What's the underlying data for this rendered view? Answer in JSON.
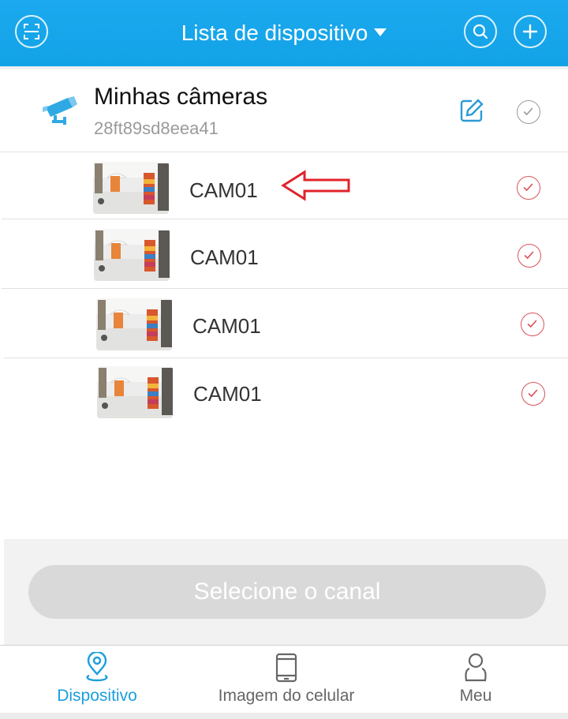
{
  "header": {
    "title": "Lista de dispositivo",
    "icons": {
      "scan": "scan-icon",
      "search": "search-icon",
      "add": "plus-icon",
      "dropdown": "caret-down-icon"
    },
    "color": "#12a2e6"
  },
  "group": {
    "name": "Minhas câmeras",
    "id": "28ft89sd8eea41",
    "icons": {
      "camera": "cctv-camera-icon",
      "edit": "edit-icon",
      "select": "check-circle-icon"
    }
  },
  "cameras": [
    {
      "label": "CAM01",
      "selected": true
    },
    {
      "label": "CAM01",
      "selected": true
    },
    {
      "label": "CAM01",
      "selected": true
    },
    {
      "label": "CAM01",
      "selected": true
    }
  ],
  "annotation": {
    "arrow_color": "#e0232b"
  },
  "action": {
    "select_channel_label": "Selecione o canal"
  },
  "nav": {
    "active_color": "#1a9fdc",
    "inactive_color": "#666666",
    "items": [
      {
        "label": "Dispositivo",
        "icon": "location-pin-icon",
        "active": true
      },
      {
        "label": "Imagem do celular",
        "icon": "tablet-icon",
        "active": false
      },
      {
        "label": "Meu",
        "icon": "person-icon",
        "active": false
      }
    ]
  }
}
